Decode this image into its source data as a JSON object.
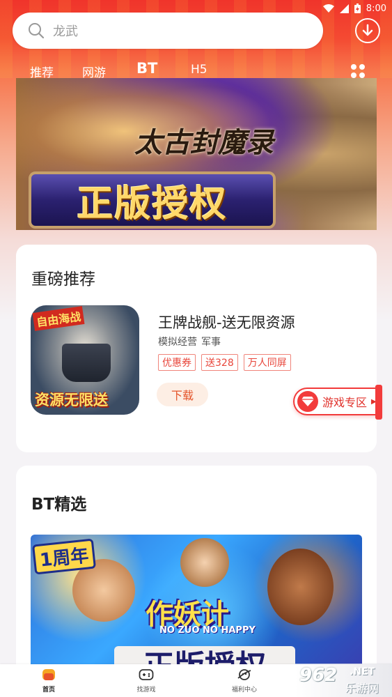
{
  "status_bar": {
    "time": "8:00"
  },
  "search": {
    "placeholder": "龙武"
  },
  "tabs": [
    {
      "label": "推荐"
    },
    {
      "label": "网游"
    },
    {
      "label": "BT"
    },
    {
      "label": "H5"
    }
  ],
  "active_tab": "BT",
  "banner": {
    "title": "太古封魔录",
    "plate": "正版授权"
  },
  "featured": {
    "section_title": "重磅推荐",
    "game": {
      "icon_tag_top": "自由海战",
      "icon_tag_bottom": "资源无限送",
      "name": "王牌战舰-送无限资源",
      "genres": [
        "模拟经营",
        "军事"
      ],
      "tags": [
        "优惠券",
        "送328",
        "万人同屏"
      ],
      "download_label": "下载"
    }
  },
  "floating_zone": {
    "label": "游戏专区"
  },
  "bt_section": {
    "title": "BT精选",
    "banner": {
      "badge": "1周年",
      "logo": "作妖计",
      "logo_sub": "NO ZUO NO HAPPY",
      "plate": "正版授权"
    }
  },
  "bottom_nav": [
    {
      "label": "首页",
      "icon": "home-icon"
    },
    {
      "label": "找游戏",
      "icon": "gamepad-icon"
    },
    {
      "label": "福利中心",
      "icon": "gift-planet-icon"
    }
  ],
  "watermark": {
    "num": "962",
    "net": ".NET",
    "cn": "乐游网"
  },
  "colors": {
    "accent": "#f0342b",
    "tag_red": "#e8453a",
    "download_bg": "#fdeee4"
  }
}
